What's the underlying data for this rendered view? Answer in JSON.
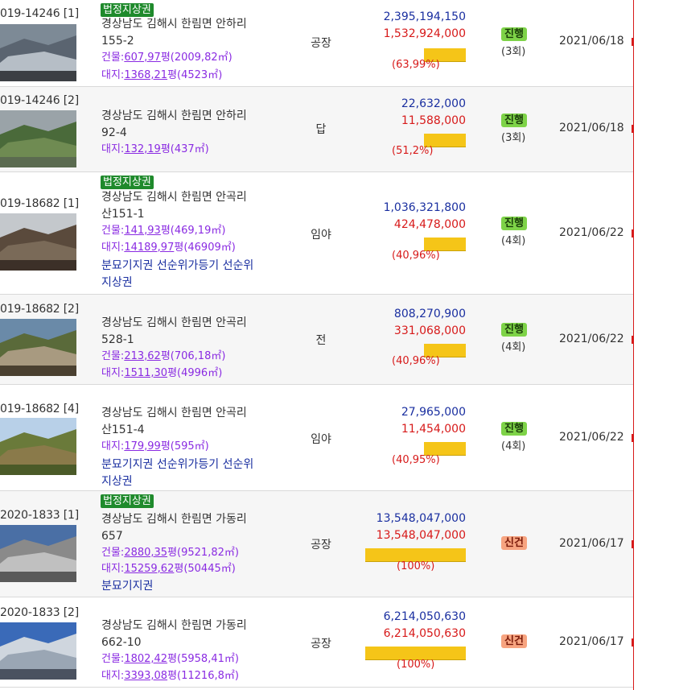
{
  "rows": [
    {
      "case": "019-14246",
      "idx": "[1]",
      "legal": "법정지상권",
      "addr1": "경상남도 김해시 한림면 안하리",
      "addr2": "155-2",
      "bldg_label": "건물:",
      "bldg_py": "607,97",
      "bldg_unit": "평",
      "bldg_m2": "(2009,82㎡)",
      "land_label": "대지:",
      "land_py": "1368,21",
      "land_unit": "평",
      "land_m2": "(4523㎡)",
      "note1": "",
      "note2": "",
      "use": "공장",
      "appraisal": "2,395,194,150",
      "minbid": "1,532,924,000",
      "pct": "(63,99%)",
      "pct_value": 63.99,
      "status": "진행",
      "count": "(3회)",
      "date": "2021/06/18"
    },
    {
      "case": "019-14246",
      "idx": "[2]",
      "legal": "",
      "addr1": "경상남도 김해시 한림면 안하리",
      "addr2": "92-4",
      "bldg_label": "",
      "bldg_py": "",
      "bldg_unit": "",
      "bldg_m2": "",
      "land_label": "대지:",
      "land_py": "132,19",
      "land_unit": "평",
      "land_m2": "(437㎡)",
      "note1": "",
      "note2": "",
      "use": "답",
      "appraisal": "22,632,000",
      "minbid": "11,588,000",
      "pct": "(51,2%)",
      "pct_value": 51.2,
      "status": "진행",
      "count": "(3회)",
      "date": "2021/06/18"
    },
    {
      "case": "019-18682",
      "idx": "[1]",
      "legal": "법정지상권",
      "addr1": "경상남도 김해시 한림면 안곡리",
      "addr2": "산151-1",
      "bldg_label": "건물:",
      "bldg_py": "141,93",
      "bldg_unit": "평",
      "bldg_m2": "(469,19㎡)",
      "land_label": "대지:",
      "land_py": "14189,97",
      "land_unit": "평",
      "land_m2": "(46909㎡)",
      "note1": "분묘기지권 선순위가등기 선순위",
      "note2": "지상권",
      "use": "임야",
      "appraisal": "1,036,321,800",
      "minbid": "424,478,000",
      "pct": "(40,96%)",
      "pct_value": 40.96,
      "status": "진행",
      "count": "(4회)",
      "date": "2021/06/22"
    },
    {
      "case": "019-18682",
      "idx": "[2]",
      "legal": "",
      "addr1": "경상남도 김해시 한림면 안곡리",
      "addr2": "528-1",
      "bldg_label": "건물:",
      "bldg_py": "213,62",
      "bldg_unit": "평",
      "bldg_m2": "(706,18㎡)",
      "land_label": "대지:",
      "land_py": "1511,30",
      "land_unit": "평",
      "land_m2": "(4996㎡)",
      "note1": "",
      "note2": "",
      "use": "전",
      "appraisal": "808,270,900",
      "minbid": "331,068,000",
      "pct": "(40,96%)",
      "pct_value": 40.96,
      "status": "진행",
      "count": "(4회)",
      "date": "2021/06/22"
    },
    {
      "case": "019-18682",
      "idx": "[4]",
      "legal": "",
      "addr1": "경상남도 김해시 한림면 안곡리",
      "addr2": "산151-4",
      "bldg_label": "",
      "bldg_py": "",
      "bldg_unit": "",
      "bldg_m2": "",
      "land_label": "대지:",
      "land_py": "179,99",
      "land_unit": "평",
      "land_m2": "(595㎡)",
      "note1": "분묘기지권 선순위가등기 선순위",
      "note2": "지상권",
      "use": "임야",
      "appraisal": "27,965,000",
      "minbid": "11,454,000",
      "pct": "(40,95%)",
      "pct_value": 40.95,
      "status": "진행",
      "count": "(4회)",
      "date": "2021/06/22"
    },
    {
      "case": "2020-1833",
      "idx": "[1]",
      "legal": "법정지상권",
      "addr1": "경상남도 김해시 한림면 가동리",
      "addr2": "657",
      "bldg_label": "건물:",
      "bldg_py": "2880,35",
      "bldg_unit": "평",
      "bldg_m2": "(9521,82㎡)",
      "land_label": "대지:",
      "land_py": "15259,62",
      "land_unit": "평",
      "land_m2": "(50445㎡)",
      "note1": "분묘기지권",
      "note2": "",
      "use": "공장",
      "appraisal": "13,548,047,000",
      "minbid": "13,548,047,000",
      "pct": "(100%)",
      "pct_value": 100,
      "status": "신건",
      "count": "",
      "date": "2021/06/17"
    },
    {
      "case": "2020-1833",
      "idx": "[2]",
      "legal": "",
      "addr1": "경상남도 김해시 한림면 가동리",
      "addr2": "662-10",
      "bldg_label": "건물:",
      "bldg_py": "1802,42",
      "bldg_unit": "평",
      "bldg_m2": "(5958,41㎡)",
      "land_label": "대지:",
      "land_py": "3393,08",
      "land_unit": "평",
      "land_m2": "(11216,8㎡)",
      "note1": "",
      "note2": "",
      "use": "공장",
      "appraisal": "6,214,050,630",
      "minbid": "6,214,050,630",
      "pct": "(100%)",
      "pct_value": 100,
      "status": "신건",
      "count": "",
      "date": "2021/06/17"
    }
  ],
  "colors": {
    "appraisal": "#1a2fa0",
    "minbid": "#d71a1a",
    "bar": "#f5c518",
    "legal_badge": "#1f8a2c",
    "ongoing": "#7ed348",
    "new": "#f7a480",
    "area": "#8a2be2"
  }
}
